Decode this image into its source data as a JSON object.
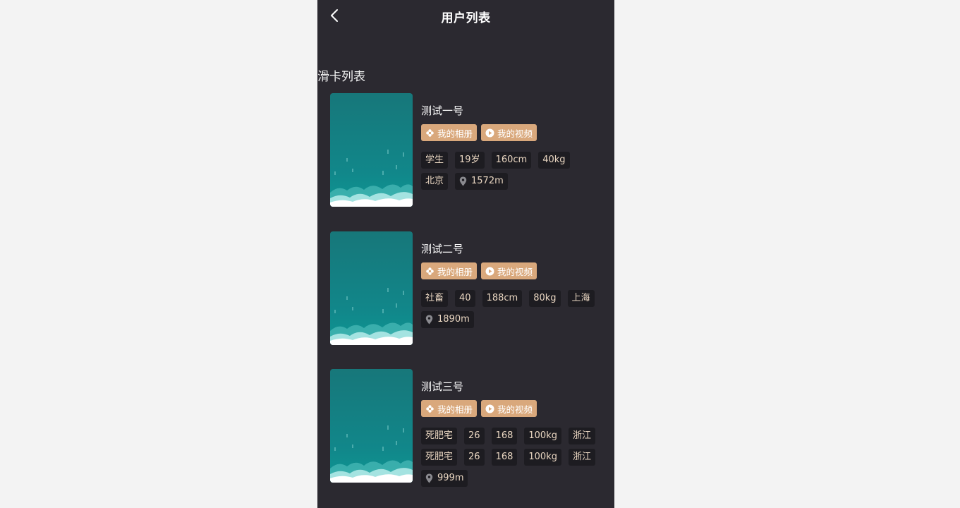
{
  "header": {
    "title": "用户列表",
    "back_icon": "chevron-left-icon"
  },
  "section": {
    "title": "滑卡列表"
  },
  "colors": {
    "page_bg": "#2b2930",
    "accent_pill": "#d9a87c",
    "tag_bg": "#1d1c21",
    "tag_text": "#e9d6c1"
  },
  "cards": [
    {
      "name": "测试一号",
      "buttons": [
        {
          "label": "我的相册",
          "icon": "flower-icon"
        },
        {
          "label": "我的视频",
          "icon": "play-icon"
        }
      ],
      "tags": [
        "学生",
        "19岁",
        "160cm",
        "40kg",
        "北京"
      ],
      "distance": "1572m"
    },
    {
      "name": "测试二号",
      "buttons": [
        {
          "label": "我的相册",
          "icon": "flower-icon"
        },
        {
          "label": "我的视频",
          "icon": "play-icon"
        }
      ],
      "tags": [
        "社畜",
        "40",
        "188cm",
        "80kg",
        "上海"
      ],
      "distance": "1890m"
    },
    {
      "name": "测试三号",
      "buttons": [
        {
          "label": "我的相册",
          "icon": "flower-icon"
        },
        {
          "label": "我的视频",
          "icon": "play-icon"
        }
      ],
      "tags": [
        "死肥宅",
        "26",
        "168",
        "100kg",
        "浙江",
        "死肥宅",
        "26",
        "168",
        "100kg",
        "浙江"
      ],
      "distance": "999m"
    }
  ]
}
